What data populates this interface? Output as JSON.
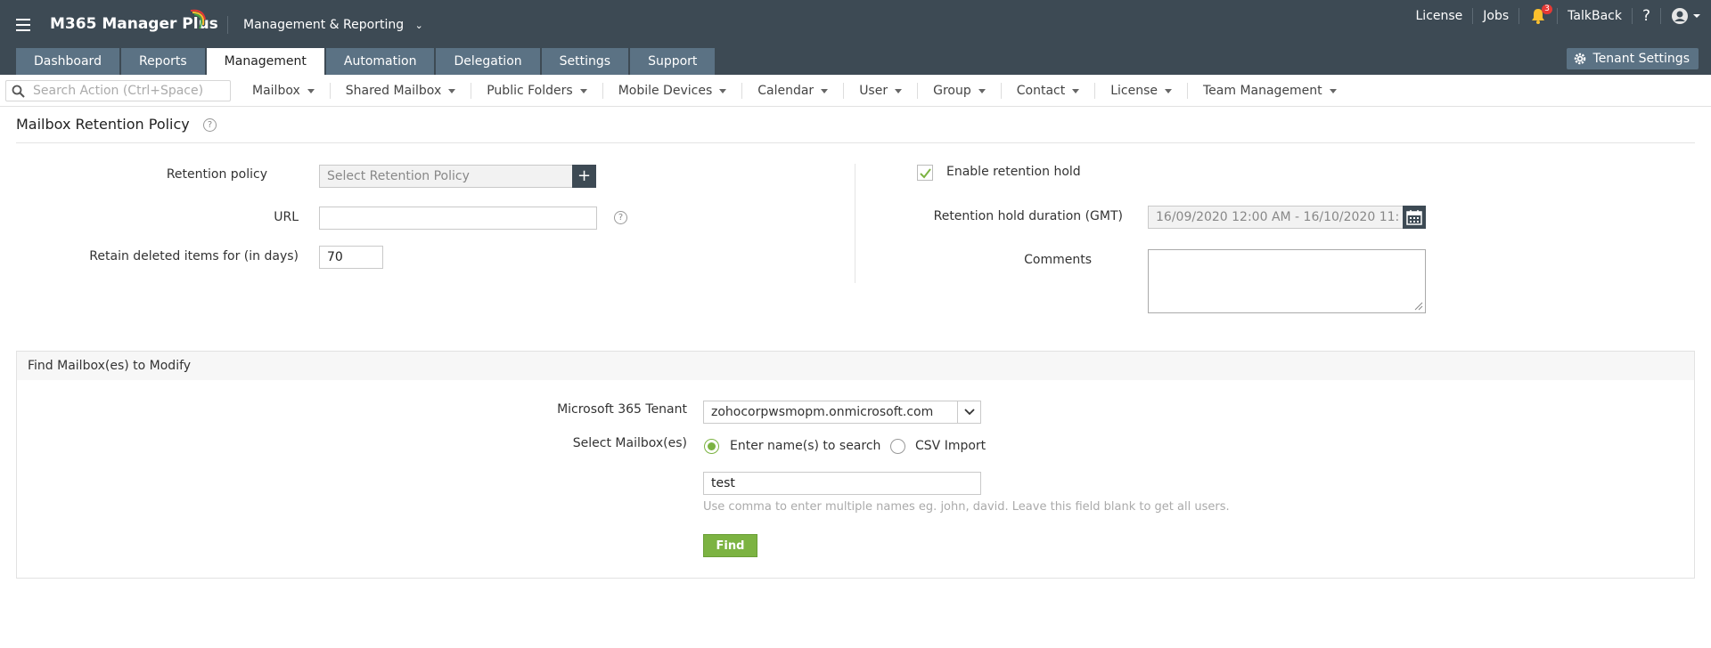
{
  "header": {
    "app_name": "M365 Manager Plus",
    "app_switcher": "Management & Reporting",
    "top_links": {
      "license": "License",
      "jobs": "Jobs",
      "talkback": "TalkBack",
      "help": "?"
    },
    "notification_count": "3",
    "tenant_settings": "Tenant Settings"
  },
  "tabs": [
    {
      "label": "Dashboard"
    },
    {
      "label": "Reports"
    },
    {
      "label": "Management",
      "active": true
    },
    {
      "label": "Automation"
    },
    {
      "label": "Delegation"
    },
    {
      "label": "Settings"
    },
    {
      "label": "Support"
    }
  ],
  "subnav": {
    "search_placeholder": "Search Action (Ctrl+Space)",
    "items": [
      "Mailbox",
      "Shared Mailbox",
      "Public Folders",
      "Mobile Devices",
      "Calendar",
      "User",
      "Group",
      "Contact",
      "License",
      "Team Management"
    ]
  },
  "page": {
    "title": "Mailbox Retention Policy"
  },
  "form": {
    "retention_policy_label": "Retention policy",
    "retention_policy_placeholder": "Select Retention Policy",
    "url_label": "URL",
    "url_value": "",
    "retain_deleted_label": "Retain deleted items for (in days)",
    "retain_deleted_value": "70",
    "enable_hold_label": "Enable retention hold",
    "enable_hold_checked": true,
    "hold_duration_label": "Retention hold duration (GMT)",
    "hold_duration_value": "16/09/2020 12:00 AM - 16/10/2020 11:",
    "comments_label": "Comments"
  },
  "find": {
    "heading": "Find Mailbox(es) to Modify",
    "tenant_label": "Microsoft 365 Tenant",
    "tenant_value": "zohocorpwsmopm.onmicrosoft.com",
    "select_label": "Select Mailbox(es)",
    "option_search": "Enter name(s) to search",
    "option_csv": "CSV Import",
    "search_value": "test",
    "hint": "Use comma to enter multiple names eg. john, david. Leave this field blank to get all users.",
    "find_button": "Find"
  },
  "colors": {
    "header": "#3d4a54",
    "tab": "#5b7284",
    "accent_green": "#7cb342"
  }
}
